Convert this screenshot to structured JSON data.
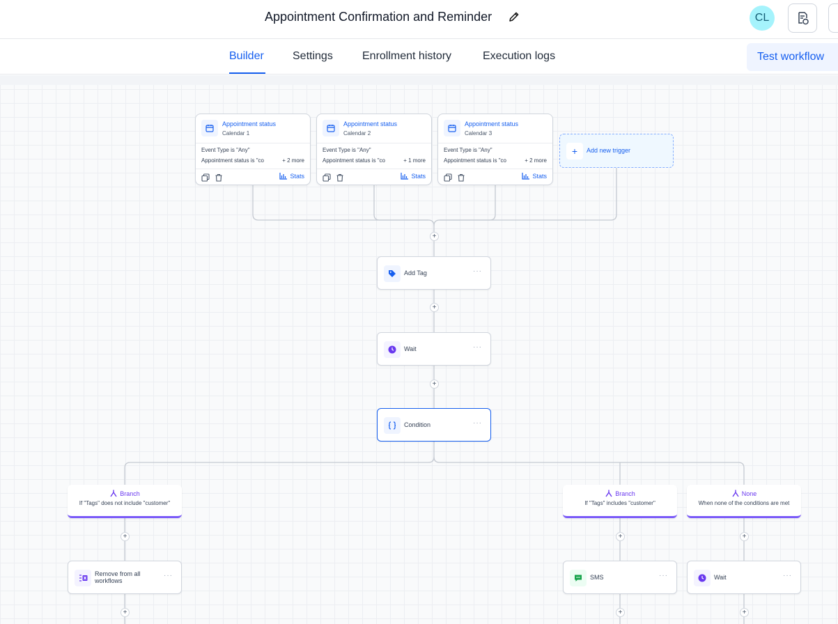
{
  "header": {
    "title": "Appointment Confirmation and Reminder",
    "avatar_initials": "CL"
  },
  "tabs": [
    {
      "label": "Builder",
      "active": true
    },
    {
      "label": "Settings",
      "active": false
    },
    {
      "label": "Enrollment history",
      "active": false
    },
    {
      "label": "Execution logs",
      "active": false
    }
  ],
  "test_button": "Test workflow",
  "triggers": [
    {
      "title": "Appointment status",
      "subtitle": "Calendar 1",
      "filter1": "Event Type is \"Any\"",
      "filter2": "Appointment status is \"co...",
      "more": "+ 2 more",
      "stats": "Stats"
    },
    {
      "title": "Appointment status",
      "subtitle": "Calendar 2",
      "filter1": "Event Type is \"Any\"",
      "filter2": "Appointment status is \"co...",
      "more": "+ 1 more",
      "stats": "Stats"
    },
    {
      "title": "Appointment status",
      "subtitle": "Calendar 3",
      "filter1": "Event Type is \"Any\"",
      "filter2": "Appointment status is \"co...",
      "more": "+ 2 more",
      "stats": "Stats"
    }
  ],
  "add_trigger": "Add new trigger",
  "actions": {
    "add_tag": "Add Tag",
    "wait": "Wait",
    "condition": "Condition",
    "remove": "Remove from all workflows",
    "sms": "SMS",
    "wait2": "Wait"
  },
  "branches": [
    {
      "heading": "Branch",
      "desc": "If \"Tags\" does not include \"customer\""
    },
    {
      "heading": "Branch",
      "desc": "If \"Tags\" includes \"customer\""
    },
    {
      "heading": "None",
      "desc": "When none of the conditions are met"
    }
  ],
  "plus_symbol": "+",
  "dots_symbol": "···",
  "colors": {
    "accent": "#155eef",
    "branch": "#7a5af8",
    "sms": "#16a34a"
  },
  "icons": [
    "pencil-icon",
    "document-check-icon",
    "calendar-icon",
    "plus-icon",
    "copy-icon",
    "trash-icon",
    "bar-chart-icon",
    "tag-icon",
    "clock-icon",
    "braces-icon",
    "branch-icon",
    "remove-workflow-icon",
    "sms-icon"
  ]
}
